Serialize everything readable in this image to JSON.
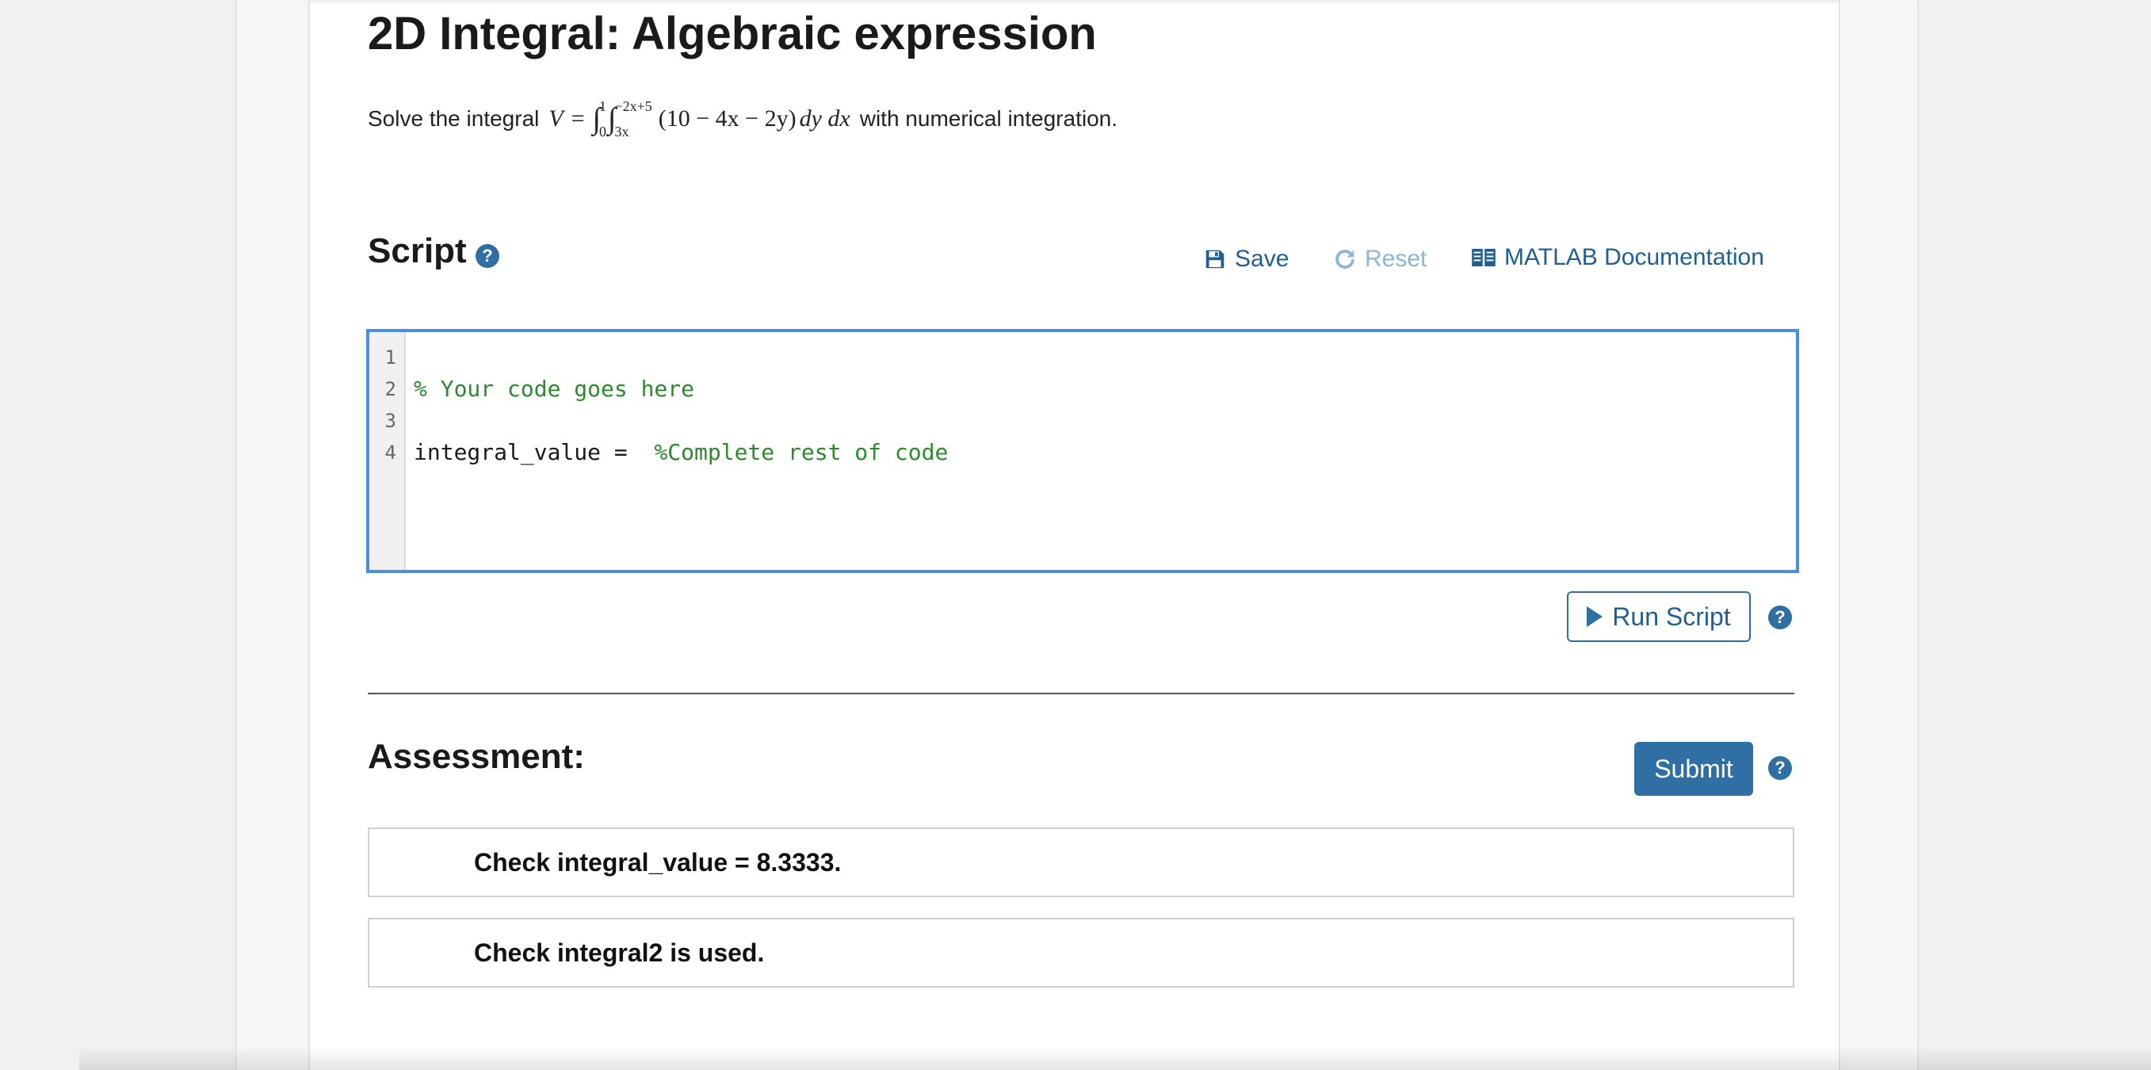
{
  "title": "2D Integral: Algebraic expression",
  "problem": {
    "prefix": "Solve the integral",
    "math": {
      "lhs": "V",
      "equals": "=",
      "outer_integral": {
        "symbol": "∫",
        "lower": "0",
        "upper": "1"
      },
      "inner_integral": {
        "symbol": "∫",
        "lower": "3x",
        "upper": "−2x+5"
      },
      "integrand": "(10 − 4x − 2y)",
      "differentials": "dy dx"
    },
    "suffix": "with numerical integration."
  },
  "script": {
    "heading": "Script",
    "help_icon": "?",
    "save_label": "Save",
    "reset_label": "Reset",
    "docs_label": "MATLAB Documentation",
    "line_numbers": [
      "1",
      "2",
      "3",
      "4"
    ],
    "lines": {
      "l2_comment": "% Your code goes here",
      "l4_code": "integral_value = ",
      "l4_comment": "%Complete rest of code"
    },
    "run_label": "Run Script",
    "run_help": "?"
  },
  "assessment": {
    "heading": "Assessment:",
    "submit_label": "Submit",
    "submit_help": "?",
    "checks": [
      "Check integral_value = 8.3333.",
      "Check integral2 is used."
    ]
  },
  "colors": {
    "accent": "#2f6fa3",
    "link": "#1f5f94",
    "disabled_link": "#8fb4d4",
    "editor_border": "#4a8ee0",
    "code_comment": "#2c8a2c"
  },
  "icons": [
    "save-icon",
    "reset-icon",
    "book-icon",
    "help-icon",
    "play-icon"
  ]
}
